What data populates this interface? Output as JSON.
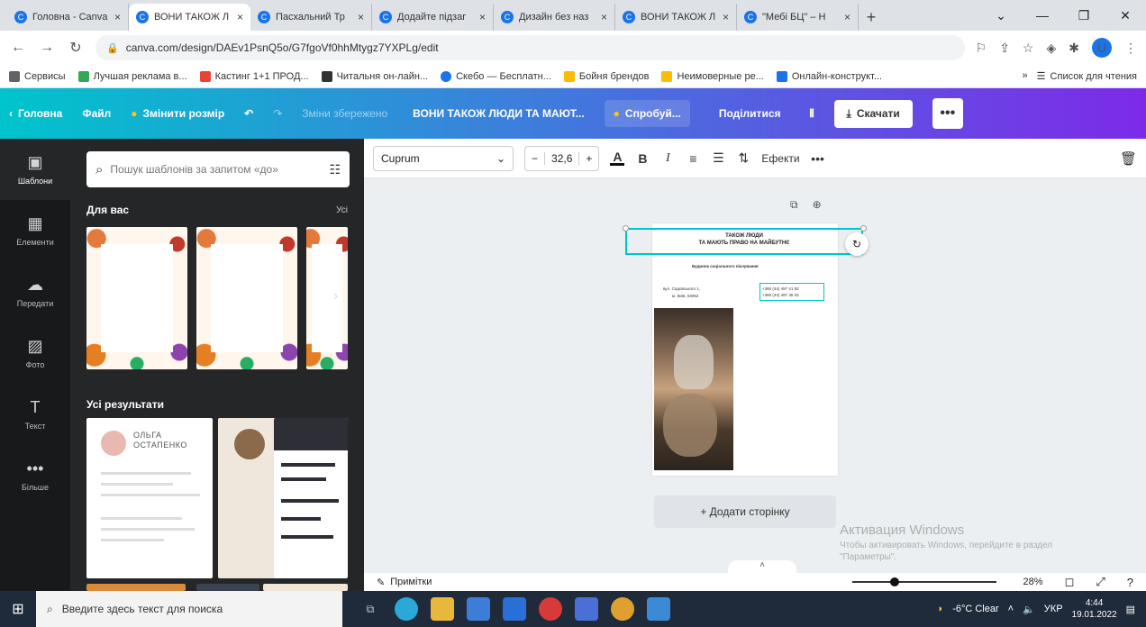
{
  "browser": {
    "tabs": [
      {
        "label": "Головна - Canva"
      },
      {
        "label": "ВОНИ ТАКОЖ Л"
      },
      {
        "label": "Пасхальний Тр"
      },
      {
        "label": "Додайте підзаг"
      },
      {
        "label": "Дизайн без наз"
      },
      {
        "label": "ВОНИ ТАКОЖ Л"
      },
      {
        "label": "\"Мебі БЦ\" – Н"
      }
    ],
    "new_tab": "+",
    "url": "canva.com/design/DAEv1PsnQ5o/G7fgoVf0hhMtygz7YXPLg/edit",
    "bookmarks": [
      {
        "label": "Сервисы",
        "color": "#5f6368"
      },
      {
        "label": "Лучшая реклама в...",
        "color": "#34a853"
      },
      {
        "label": "Кастинг 1+1 ПРОД...",
        "color": "#ea4335"
      },
      {
        "label": "Читальня он-лайн...",
        "color": "#333333"
      },
      {
        "label": "Скебо — Бесплатн...",
        "color": "#1a73e8"
      },
      {
        "label": "Бойня брендов",
        "color": "#fbbc04"
      },
      {
        "label": "Неимоверные ре...",
        "color": "#fbbc04"
      },
      {
        "label": "Онлайн-конструкт...",
        "color": "#1a73e8"
      }
    ],
    "bookmarks_right": [
      "»",
      "Список для чтения"
    ],
    "profile_initial": "U"
  },
  "canva": {
    "home": "Головна",
    "file": "Файл",
    "resize": "Змінити розмір",
    "saved": "Зміни збережено",
    "title": "ВОНИ ТАКОЖ ЛЮДИ ТА МАЮТ...",
    "try": "Спробуй...",
    "share": "Поділитися",
    "download": "Скачати",
    "more": "•••"
  },
  "rail": [
    {
      "label": "Шаблони",
      "icon": "▣"
    },
    {
      "label": "Елементи",
      "icon": "▦"
    },
    {
      "label": "Передати",
      "icon": "☁"
    },
    {
      "label": "Фото",
      "icon": "▨"
    },
    {
      "label": "Текст",
      "icon": "T"
    },
    {
      "label": "Більше",
      "icon": "•••"
    }
  ],
  "panel": {
    "search_placeholder": "Пошук шаблонів за запитом «до»",
    "for_you": "Для вас",
    "all": "Усі",
    "all_results": "Усі результати",
    "resume_name": "ОЛЬГА\nОСТАПЕНКО"
  },
  "toolbar": {
    "font": "Cuprum",
    "minus": "−",
    "size": "32,6",
    "plus": "+",
    "effects": "Ефекти",
    "more": "•••"
  },
  "page": {
    "heading_line1": "ТАКОЖ ЛЮДИ",
    "heading_line2": "ТА МАЮТЬ ПРАВО НА МАЙБУТНЄ",
    "subheading": "Будинок соціального піклування",
    "address_line1": "вул. Садовського 1,",
    "address_line2": "м. Київ, 03062",
    "phone1": "+380 (44) 497 41 82",
    "phone2": "+380 (44) 497 35 03",
    "add_page": "+ Додати сторінку"
  },
  "watermark": {
    "title": "Активация Windows",
    "text": "Чтобы активировать Windows, перейдите в раздел \"Параметры\"."
  },
  "bottom": {
    "notes": "Примітки",
    "zoom": "28%",
    "zoom_level": 0.28
  },
  "taskbar": {
    "search": "Введите здесь текст для поиска",
    "weather": "-6°C Clear",
    "lang": "УКР",
    "time": "4:44",
    "date": "19.01.2022"
  }
}
